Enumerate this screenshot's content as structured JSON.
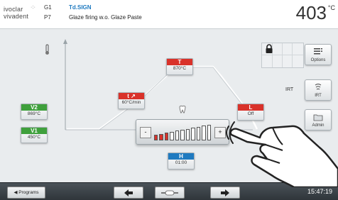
{
  "header": {
    "logo_line1": "ivoclar",
    "logo_line2": "vivadent",
    "program_group": "G1",
    "program_number": "P7",
    "program_tag": "Td.SIGN",
    "program_name": "Glaze firing w.o. Glaze Paste",
    "temperature": "403",
    "temperature_unit": "°C"
  },
  "firing_steps": {
    "V2": {
      "label": "V2",
      "value": "869°C"
    },
    "V1": {
      "label": "V1",
      "value": "450°C"
    },
    "T": {
      "label": "T",
      "value": "870°C"
    },
    "t": {
      "label": "t ↗",
      "value": "60°C/min"
    },
    "L": {
      "label": "L",
      "value": "Off"
    },
    "H": {
      "label": "H",
      "value": "01:00"
    }
  },
  "vacuum_dial": {
    "minus_label": "-",
    "plus_label": "+",
    "level": 0.3,
    "bar_count": 11
  },
  "side_panel": {
    "options_label": "Options",
    "irt_text": "IRT",
    "irt_button_label": "IRT",
    "admin_label": "Admin"
  },
  "bottom_bar": {
    "programs_label": "◀ Programs",
    "prev_icon": "arrow-left-icon",
    "home_icon": "slider-icon",
    "next_icon": "arrow-right-icon",
    "clock": "15:47:19"
  },
  "colors": {
    "red": "#d9322a",
    "green": "#3fa03c",
    "blue": "#1f7ac0",
    "bar_active": "#d9322a",
    "bar_inactive": "#ffffff"
  }
}
